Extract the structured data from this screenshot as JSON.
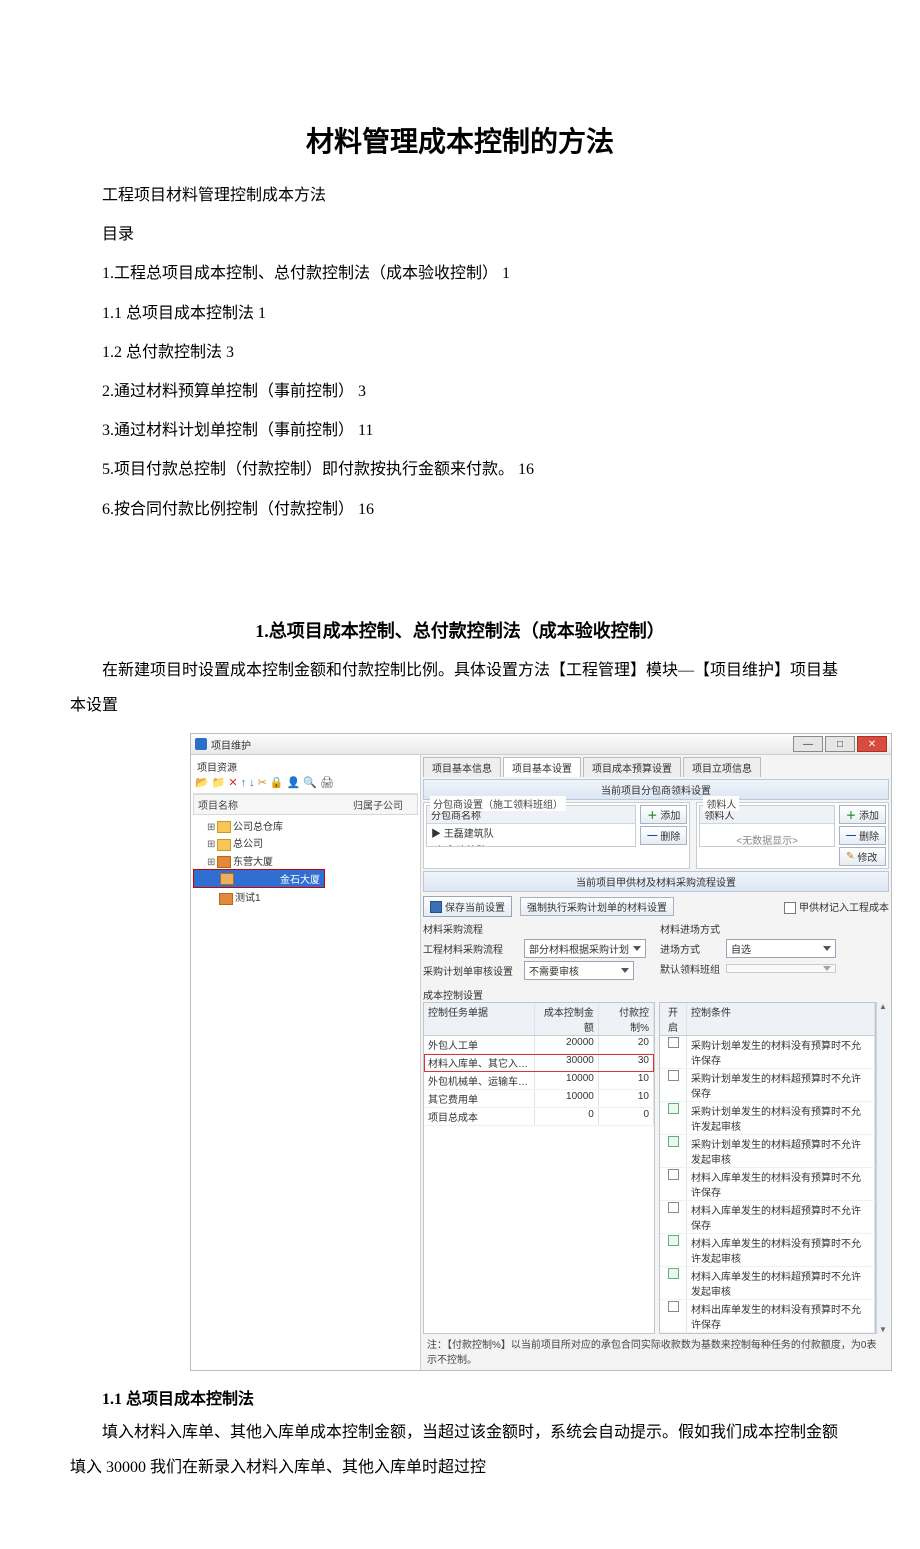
{
  "title": "材料管理成本控制的方法",
  "intro": "工程项目材料管理控制成本方法",
  "toc_label": "目录",
  "toc": [
    "1.工程总项目成本控制、总付款控制法（成本验收控制） 1",
    "1.1 总项目成本控制法 1",
    "1.2 总付款控制法 3",
    "2.通过材料预算单控制（事前控制） 3",
    "3.通过材料计划单控制（事前控制） 11",
    "5.项目付款总控制（付款控制）即付款按执行金额来付款。 16",
    "6.按合同付款比例控制（付款控制） 16"
  ],
  "h2": "1.总项目成本控制、总付款控制法（成本验收控制）",
  "p1": "在新建项目时设置成本控制金额和付款控制比例。具体设置方法【工程管理】模块—【项目维护】项目基本设置",
  "h3": "1.1 总项目成本控制法",
  "p2": "填入材料入库单、其他入库单成本控制金额，当超过该金额时，系统会自动提示。假如我们成本控制金额填入 30000 我们在新录入材料入库单、其他入库单时超过控",
  "dlg": {
    "title": "项目维护",
    "leftHeader": "项目资源",
    "toolbarIcons": [
      "folder-open-icon",
      "folder-new-icon",
      "delete-icon",
      "up-icon",
      "down-icon",
      "cut-icon",
      "lock-icon",
      "user-icon",
      "search-icon",
      "print-icon"
    ],
    "treeCols": {
      "name": "项目名称",
      "owner": "归属子公司"
    },
    "tree": [
      {
        "label": "公司总仓库",
        "icon": "fd"
      },
      {
        "label": "总公司",
        "icon": "fd"
      },
      {
        "label": "东营大厦",
        "icon": "hs"
      },
      {
        "label": "金石大厦",
        "icon": "hs",
        "selected": true
      },
      {
        "label": "测试1",
        "icon": "hs"
      }
    ],
    "tabs": [
      "项目基本信息",
      "项目基本设置",
      "项目成本预算设置",
      "项目立项信息"
    ],
    "sectionA": "当前项目分包商领料设置",
    "fsA": {
      "legend": "分包商设置（施工领料班组）",
      "col": "分包商名称",
      "items": [
        "王磊建筑队",
        "赵永建筑队"
      ],
      "addBtn": "添加",
      "delBtn": "删除"
    },
    "fsB": {
      "legend": "领料人",
      "col": "领料人",
      "nodata": "<无数据显示>",
      "addBtn": "添加",
      "delBtn": "删除",
      "editBtn": "修改"
    },
    "sectionB": "当前项目甲供材及材料采购流程设置",
    "saveBtn": "保存当前设置",
    "forceBtn": "强制执行采购计划单的材料设置",
    "chkA": "甲供材记入工程成本",
    "grpLeft": "材料采购流程",
    "grpRight": "材料进场方式",
    "row1l": "工程材料采购流程",
    "row1lv": "部分材料根据采购计划",
    "row2l": "采购计划单审核设置",
    "row2lv": "不需要审核",
    "row1r": "进场方式",
    "row1rv": "自选",
    "row2r": "默认领料班组",
    "grpCost": "成本控制设置",
    "gridA": {
      "h": [
        "控制任务单据",
        "成本控制金额",
        "付款控制%"
      ],
      "rows": [
        {
          "a": "外包人工单",
          "b": "20000",
          "c": "20"
        },
        {
          "a": "材料入库单、其它入…",
          "b": "30000",
          "c": "30",
          "hl": true
        },
        {
          "a": "外包机械单、运输车…",
          "b": "10000",
          "c": "10"
        },
        {
          "a": "其它费用单",
          "b": "10000",
          "c": "10"
        },
        {
          "a": "项目总成本",
          "b": "0",
          "c": "0"
        }
      ]
    },
    "gridB": {
      "h": [
        "开启",
        "控制条件"
      ],
      "rows": [
        {
          "on": false,
          "t": "采购计划单发生的材料没有预算时不允许保存"
        },
        {
          "on": false,
          "t": "采购计划单发生的材料超预算时不允许保存"
        },
        {
          "on": true,
          "t": "采购计划单发生的材料没有预算时不允许发起审核"
        },
        {
          "on": true,
          "t": "采购计划单发生的材料超预算时不允许发起审核"
        },
        {
          "on": false,
          "t": "材料入库单发生的材料没有预算时不允许保存"
        },
        {
          "on": false,
          "t": "材料入库单发生的材料超预算时不允许保存"
        },
        {
          "on": true,
          "t": "材料入库单发生的材料没有预算时不允许发起审核"
        },
        {
          "on": true,
          "t": "材料入库单发生的材料超预算时不允许发起审核"
        },
        {
          "on": false,
          "t": "材料出库单发生的材料没有预算时不允许保存"
        }
      ]
    },
    "note": "注：【付款控制%】以当前项目所对应的承包合同实际收款数为基数来控制每种任务的付款额度，为0表示不控制。"
  }
}
